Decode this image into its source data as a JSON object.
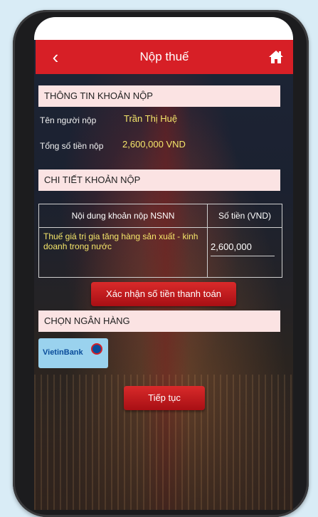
{
  "header": {
    "title": "Nộp thuế"
  },
  "section_info": {
    "title": "THÔNG TIN KHOẢN NỘP"
  },
  "payer": {
    "label": "Tên người nộp",
    "value": "Trần Thị Huệ"
  },
  "total": {
    "label": "Tổng số tiền nộp",
    "value": "2,600,000 VND"
  },
  "section_detail": {
    "title": "CHI TIẾT KHOẢN NỘP"
  },
  "table": {
    "headers": [
      "Nội dung khoản nộp NSNN",
      "Số tiền (VND)"
    ],
    "rows": [
      {
        "content": "Thuế giá trị gia tăng hàng sản xuất - kinh doanh trong nước",
        "amount": "2,600,000"
      }
    ]
  },
  "confirm_button": {
    "label": "Xác nhận số tiền thanh toán"
  },
  "section_bank": {
    "title": "CHỌN NGÂN HÀNG"
  },
  "bank": {
    "name": "VietinBank"
  },
  "continue_button": {
    "label": "Tiếp tục"
  },
  "colors": {
    "header": "#d71f26",
    "section_bar": "#fbe3e3",
    "value_text": "#f5e66a"
  },
  "icons": {
    "back": "chevron-left-icon",
    "home": "home-icon"
  }
}
